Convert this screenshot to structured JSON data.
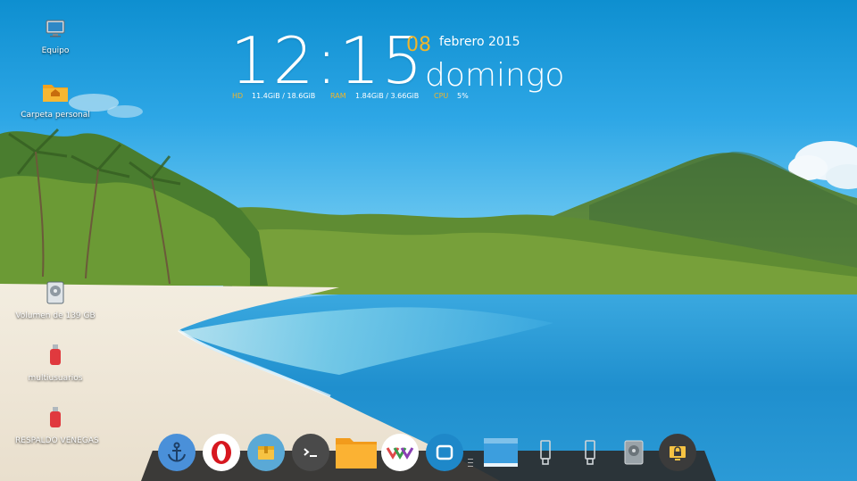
{
  "desktop": {
    "wallpaper": "beach-landscape",
    "icons": [
      {
        "label": "Equipo",
        "icon": "computer-icon"
      },
      {
        "label": "Carpeta personal",
        "icon": "home-folder-icon"
      },
      {
        "label": "Volumen de 139 GB",
        "icon": "drive-icon"
      },
      {
        "label": "multiusuarios",
        "icon": "usb-drive-icon"
      },
      {
        "label": "RESPALDO VENEGAS",
        "icon": "usb-drive-icon"
      }
    ]
  },
  "clock_widget": {
    "time": "12:15",
    "day": "08",
    "month_year": "febrero 2015",
    "weekday": "domingo",
    "stats": {
      "hd_label": "HD",
      "hd_value": "11.4GiB / 18.6GiB",
      "ram_label": "RAM",
      "ram_value": "1.84GiB / 3.66GiB",
      "cpu_label": "CPU",
      "cpu_value": "5%"
    },
    "accent_color": "#f0b52a"
  },
  "dock": {
    "items": [
      {
        "name": "launcher",
        "icon": "anchor-icon"
      },
      {
        "name": "opera",
        "icon": "opera-icon"
      },
      {
        "name": "archive-manager",
        "icon": "archive-icon"
      },
      {
        "name": "terminal",
        "icon": "terminal-icon"
      },
      {
        "name": "files",
        "icon": "folder-icon"
      },
      {
        "name": "app-store",
        "icon": "store-icon"
      },
      {
        "name": "screenshot",
        "icon": "screenshot-icon"
      },
      {
        "name": "desktop",
        "icon": "desktop-icon"
      },
      {
        "name": "removable-device-1",
        "icon": "usb-device-icon"
      },
      {
        "name": "removable-device-2",
        "icon": "usb-device-icon"
      },
      {
        "name": "drive",
        "icon": "hard-drive-icon"
      },
      {
        "name": "lock-screen",
        "icon": "lock-icon"
      }
    ]
  }
}
